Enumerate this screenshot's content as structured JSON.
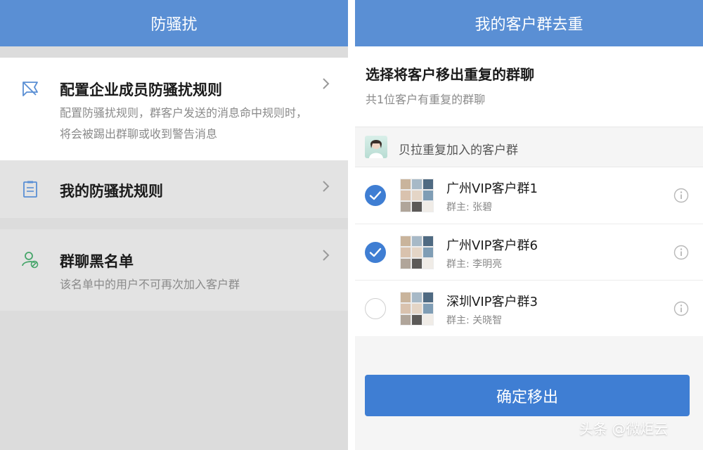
{
  "left": {
    "header_title": "防骚扰",
    "menu": [
      {
        "title": "配置企业成员防骚扰规则",
        "desc": "配置防骚扰规则，群客户发送的消息命中规则时，将会被踢出群聊或收到警告消息",
        "icon": "flag-icon"
      },
      {
        "title": "我的防骚扰规则",
        "icon": "clipboard-icon"
      },
      {
        "title": "群聊黑名单",
        "desc": "该名单中的用户不可再次加入客户群",
        "icon": "user-block-icon"
      }
    ]
  },
  "right": {
    "header_title": "我的客户群去重",
    "title": "选择将客户移出重复的群聊",
    "subtitle": "共1位客户有重复的群聊",
    "section_label": "贝拉重复加入的客户群",
    "groups": [
      {
        "name": "广州VIP客户群1",
        "owner": "群主: 张碧",
        "checked": true
      },
      {
        "name": "广州VIP客户群6",
        "owner": "群主: 李明亮",
        "checked": true
      },
      {
        "name": "深圳VIP客户群3",
        "owner": "群主: 关晓智",
        "checked": false
      }
    ],
    "confirm_label": "确定移出"
  },
  "watermark": "头条 @微炬云",
  "colors": {
    "header": "#5a8fd4",
    "accent": "#3f7ed3",
    "left_bg": "#dcdcdc",
    "muted_text": "#8a8a8a"
  }
}
